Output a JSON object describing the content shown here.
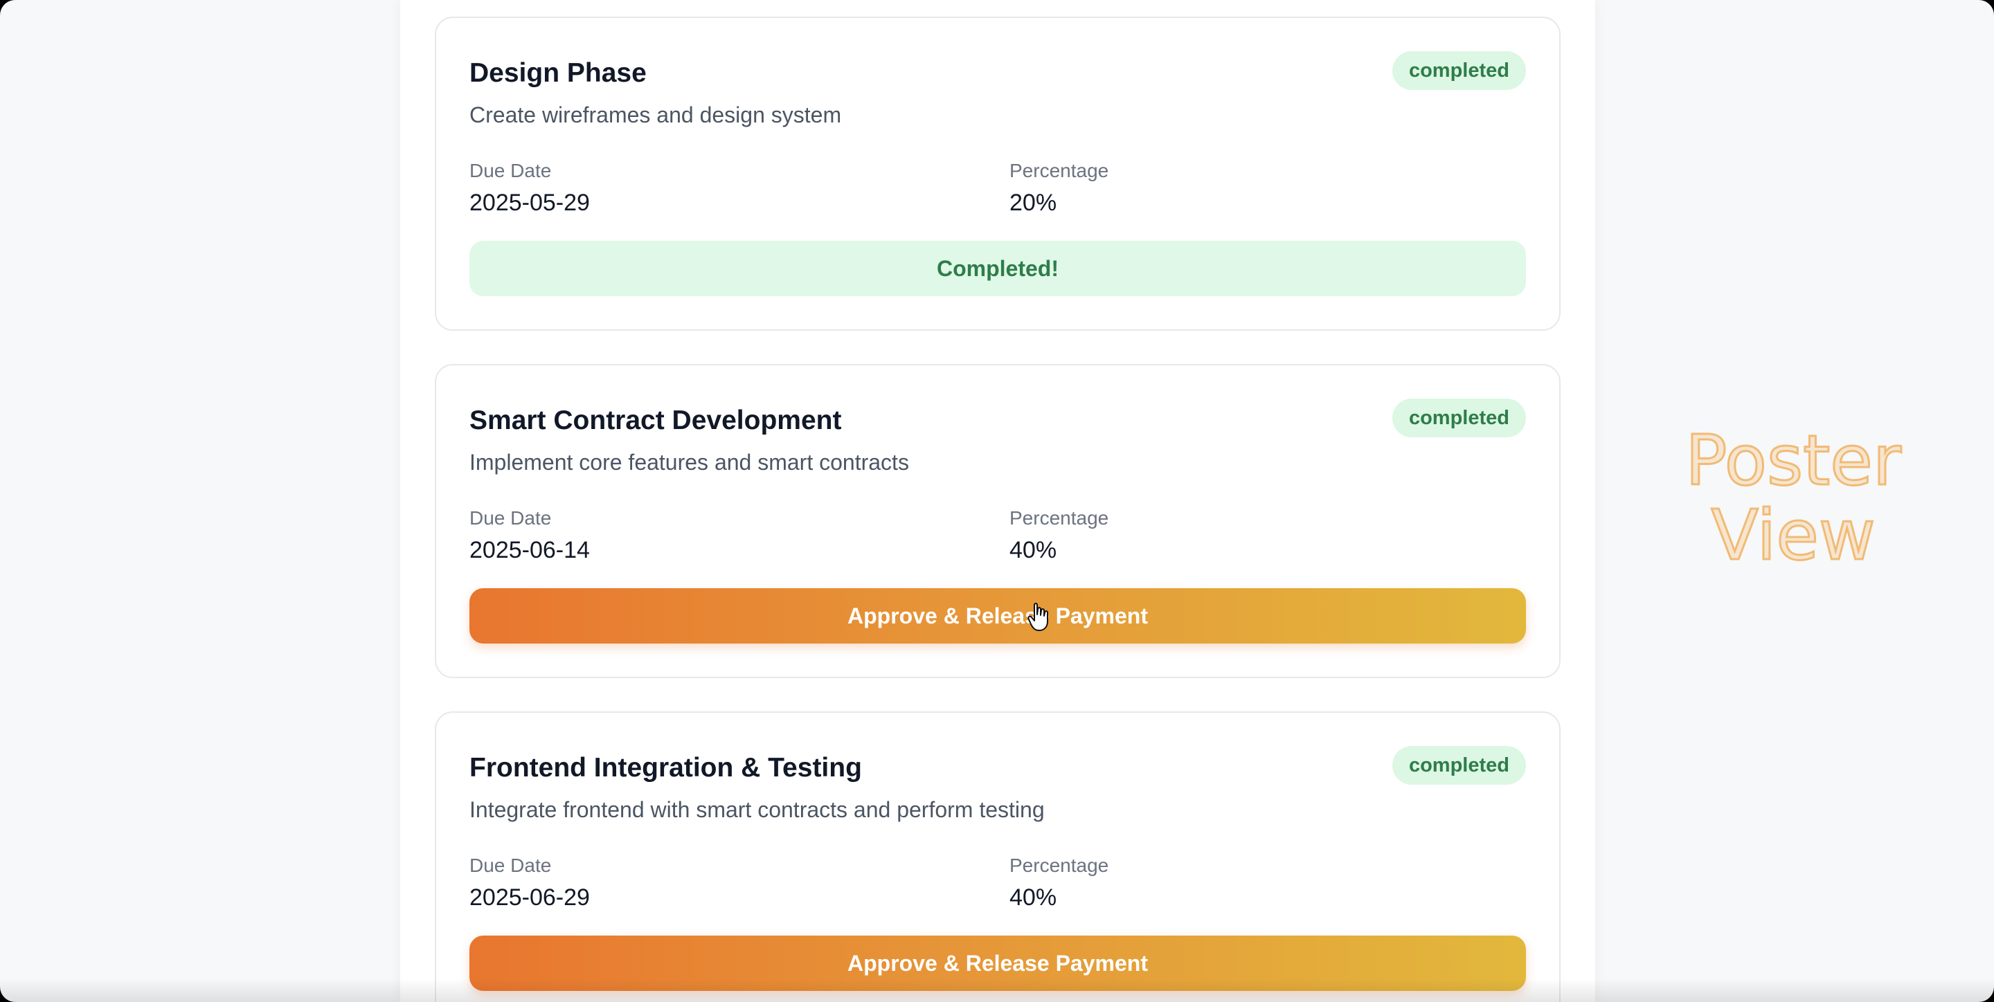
{
  "milestones": [
    {
      "title": "Design Phase",
      "status": "completed",
      "description": "Create wireframes and design system",
      "due_date_label": "Due Date",
      "due_date": "2025-05-29",
      "percentage_label": "Percentage",
      "percentage": "20%",
      "action_label": "Completed!"
    },
    {
      "title": "Smart Contract Development",
      "status": "completed",
      "description": "Implement core features and smart contracts",
      "due_date_label": "Due Date",
      "due_date": "2025-06-14",
      "percentage_label": "Percentage",
      "percentage": "40%",
      "action_label": "Approve & Release Payment"
    },
    {
      "title": "Frontend Integration & Testing",
      "status": "completed",
      "description": "Integrate frontend with smart contracts and perform testing",
      "due_date_label": "Due Date",
      "due_date": "2025-06-29",
      "percentage_label": "Percentage",
      "percentage": "40%",
      "action_label": "Approve & Release Payment"
    }
  ],
  "watermark": {
    "line1": "Poster",
    "line2": "View"
  },
  "colors": {
    "status_badge_bg": "#dcf7e3",
    "status_badge_text": "#2e7d4a",
    "approve_gradient_start": "#e8762f",
    "approve_gradient_end": "#e2b83c"
  },
  "icons": {
    "cursor": "hand-pointer-icon"
  }
}
